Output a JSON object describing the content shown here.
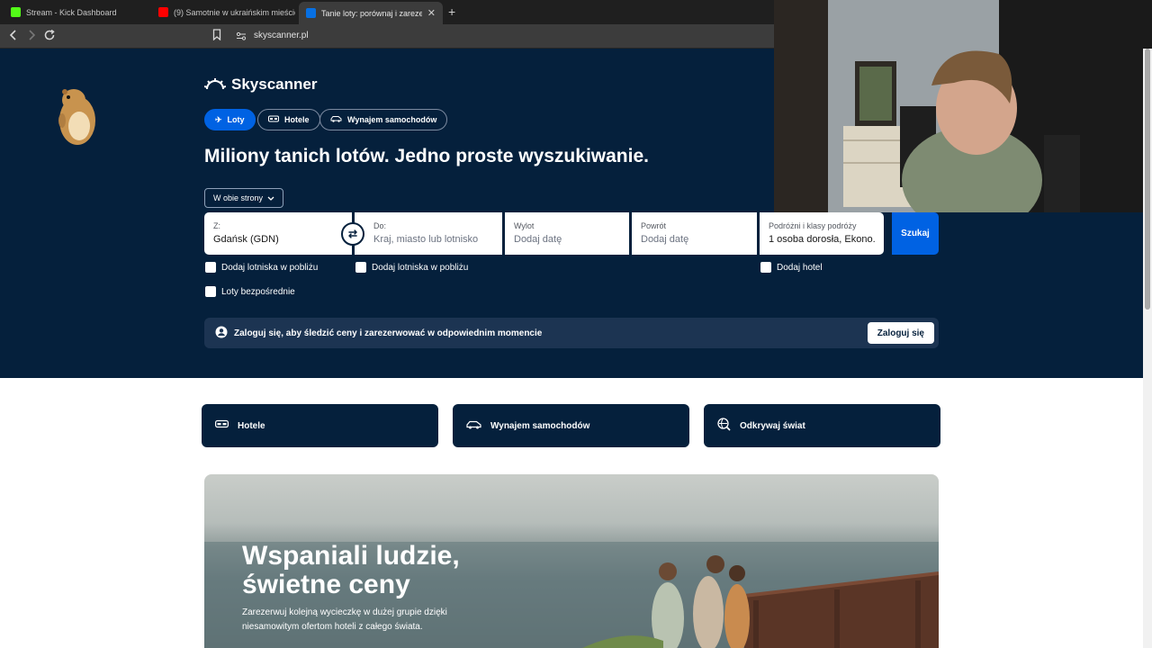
{
  "browser": {
    "tabs": [
      {
        "title": "Stream - Kick Dashboard",
        "favicon_color": "#53fc18"
      },
      {
        "title": "(9) Samotnie w ukraińskim mieście na",
        "favicon_color": "#ff0000"
      },
      {
        "title": "Tanie loty: porównaj i zarezerwuj",
        "favicon_color": "#0770e3"
      }
    ],
    "url": "skyscanner.pl"
  },
  "header": {
    "logo_text": "Skyscanner"
  },
  "nav_pills": [
    {
      "label": "Loty",
      "icon": "plane-icon",
      "active": true
    },
    {
      "label": "Hotele",
      "icon": "bed-icon",
      "active": false
    },
    {
      "label": "Wynajem samochodów",
      "icon": "car-icon",
      "active": false
    }
  ],
  "headline": "Miliony tanich lotów. Jedno proste wyszukiwanie.",
  "trip_type": "W obie strony",
  "search": {
    "from": {
      "label": "Z:",
      "value": "Gdańsk (GDN)"
    },
    "to": {
      "label": "Do:",
      "placeholder": "Kraj, miasto lub lotnisko"
    },
    "depart": {
      "label": "Wylot",
      "placeholder": "Dodaj datę"
    },
    "return": {
      "label": "Powrót",
      "placeholder": "Dodaj datę"
    },
    "travellers": {
      "label": "Podróżni i klasy podróży",
      "value": "1 osoba dorosła, Ekono..."
    },
    "button": "Szukaj"
  },
  "checkboxes": {
    "nearby_from": "Dodaj lotniska w pobliżu",
    "nearby_to": "Dodaj lotniska w pobliżu",
    "hotel": "Dodaj hotel",
    "direct": "Loty bezpośrednie"
  },
  "login_bar": {
    "text": "Zaloguj się, aby śledzić ceny i zarezerwować w odpowiednim momencie",
    "button": "Zaloguj się"
  },
  "cards": [
    {
      "label": "Hotele",
      "icon": "bed-icon"
    },
    {
      "label": "Wynajem samochodów",
      "icon": "car-icon"
    },
    {
      "label": "Odkrywaj świat",
      "icon": "globe-search-icon"
    }
  ],
  "promo": {
    "title": "Wspaniali ludzie, świetne ceny",
    "text": "Zarezerwuj kolejną wycieczkę w dużej grupie dzięki niesamowitym ofertom hoteli z całego świata."
  },
  "colors": {
    "brand_dark": "#05203c",
    "brand_blue": "#0062e3"
  }
}
